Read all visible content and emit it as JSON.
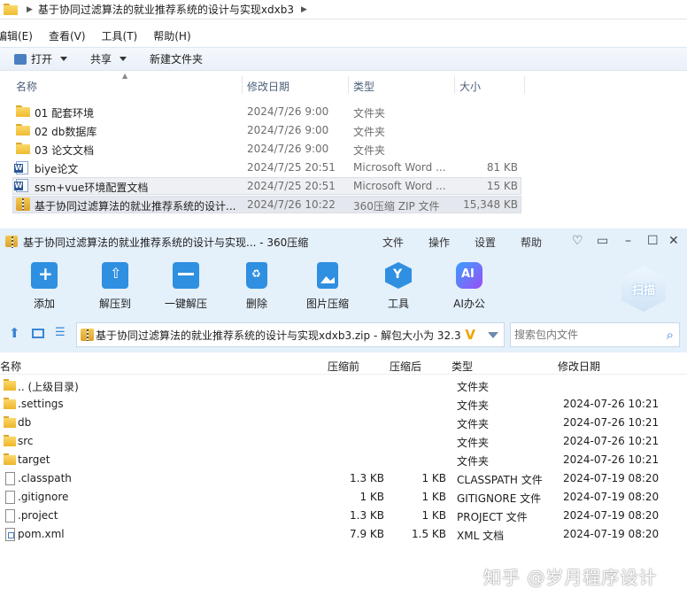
{
  "explorer": {
    "breadcrumb": "基于协同过滤算法的就业推荐系统的设计与实现xdxb3",
    "menus": [
      "编辑(E)",
      "查看(V)",
      "工具(T)",
      "帮助(H)"
    ],
    "toolbar": {
      "open": "打开",
      "share": "共享",
      "new_folder": "新建文件夹"
    },
    "columns": {
      "name": "名称",
      "modified": "修改日期",
      "type": "类型",
      "size": "大小"
    },
    "rows": [
      {
        "name": "01 配套环境",
        "modified": "2024/7/26 9:00",
        "type": "文件夹",
        "size": ""
      },
      {
        "name": "02 db数据库",
        "modified": "2024/7/26 9:00",
        "type": "文件夹",
        "size": ""
      },
      {
        "name": "03 论文文档",
        "modified": "2024/7/26 9:00",
        "type": "文件夹",
        "size": ""
      },
      {
        "name": "biye论文",
        "modified": "2024/7/25 20:51",
        "type": "Microsoft Word ...",
        "size": "81 KB"
      },
      {
        "name": "ssm+vue环境配置文档",
        "modified": "2024/7/25 20:51",
        "type": "Microsoft Word ...",
        "size": "15 KB"
      },
      {
        "name": "基于协同过滤算法的就业推荐系统的设计...",
        "modified": "2024/7/26 10:22",
        "type": "360压缩 ZIP 文件",
        "size": "15,348 KB"
      }
    ]
  },
  "zip": {
    "title": "基于协同过滤算法的就业推荐系统的设计与实现... - 360压缩",
    "menus": [
      "文件",
      "操作",
      "设置",
      "帮助"
    ],
    "tools": [
      {
        "label": "添加",
        "icon": "add-icon",
        "color": "#2f8fe0"
      },
      {
        "label": "解压到",
        "icon": "extract-to-icon",
        "color": "#2f8fe0"
      },
      {
        "label": "一键解压",
        "icon": "one-click-extract-icon",
        "color": "#2f8fe0"
      },
      {
        "label": "删除",
        "icon": "trash-icon",
        "color": "#2f8fe0"
      },
      {
        "label": "图片压缩",
        "icon": "image-compress-icon",
        "color": "#2f8fe0"
      },
      {
        "label": "工具",
        "icon": "tools-icon",
        "color": "#2f8fe0"
      },
      {
        "label": "AI办公",
        "icon": "ai-office-icon",
        "color": "#7b5cf0"
      }
    ],
    "scan_label": "扫描",
    "path": "基于协同过滤算法的就业推荐系统的设计与实现xdxb3.zip - 解包大小为 32.3",
    "search_placeholder": "搜索包内文件",
    "columns": {
      "name": "名称",
      "before": "压缩前",
      "after": "压缩后",
      "type": "类型",
      "modified": "修改日期"
    },
    "rows": [
      {
        "name": ".. (上级目录)",
        "before": "",
        "after": "",
        "type": "文件夹",
        "modified": "",
        "kind": "folder"
      },
      {
        "name": ".settings",
        "before": "",
        "after": "",
        "type": "文件夹",
        "modified": "2024-07-26 10:21",
        "kind": "folder"
      },
      {
        "name": "db",
        "before": "",
        "after": "",
        "type": "文件夹",
        "modified": "2024-07-26 10:21",
        "kind": "folder"
      },
      {
        "name": "src",
        "before": "",
        "after": "",
        "type": "文件夹",
        "modified": "2024-07-26 10:21",
        "kind": "folder"
      },
      {
        "name": "target",
        "before": "",
        "after": "",
        "type": "文件夹",
        "modified": "2024-07-26 10:21",
        "kind": "folder"
      },
      {
        "name": ".classpath",
        "before": "1.3 KB",
        "after": "1 KB",
        "type": "CLASSPATH 文件",
        "modified": "2024-07-19 08:20",
        "kind": "file"
      },
      {
        "name": ".gitignore",
        "before": "1 KB",
        "after": "1 KB",
        "type": "GITIGNORE 文件",
        "modified": "2024-07-19 08:20",
        "kind": "file"
      },
      {
        "name": ".project",
        "before": "1.3 KB",
        "after": "1 KB",
        "type": "PROJECT 文件",
        "modified": "2024-07-19 08:20",
        "kind": "file"
      },
      {
        "name": "pom.xml",
        "before": "7.9 KB",
        "after": "1.5 KB",
        "type": "XML 文档",
        "modified": "2024-07-19 08:20",
        "kind": "xml"
      }
    ]
  },
  "watermark": "知乎 @岁月程序设计"
}
